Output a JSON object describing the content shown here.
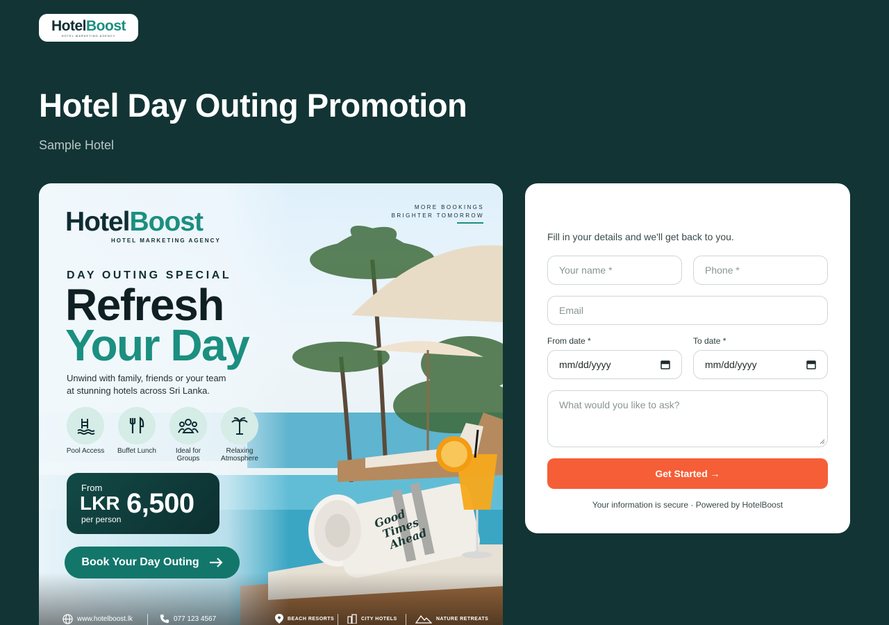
{
  "header": {
    "logo_text_h": "Hotel",
    "logo_text_b": "Boost",
    "logo_subtext": "HOTEL MARKETING AGENCY",
    "title": "Hotel Day Outing Promotion",
    "subtitle": "Sample Hotel"
  },
  "poster": {
    "logo_text_h": "Hotel",
    "logo_text_b": "Boost",
    "logo_subtext": "HOTEL MARKETING AGENCY",
    "tagline_line1": "MORE BOOKINGS",
    "tagline_line2": "BRIGHTER TOMORROW",
    "kicker": "DAY OUTING SPECIAL",
    "headline_line1": "Refresh",
    "headline_line2": "Your Day",
    "blurb_line1": "Unwind with family, friends or your team",
    "blurb_line2": "at stunning hotels across Sri Lanka.",
    "amenities": [
      {
        "icon": "pool-icon",
        "line1": "Pool Access",
        "line2": ""
      },
      {
        "icon": "fork-knife-icon",
        "line1": "Buffet Lunch",
        "line2": ""
      },
      {
        "icon": "group-icon",
        "line1": "Ideal for",
        "line2": "Groups"
      },
      {
        "icon": "palm-tree-icon",
        "line1": "Relaxing",
        "line2": "Atmosphere"
      }
    ],
    "price_from": "From",
    "price_currency": "LKR",
    "price_value": "6,500",
    "price_per": "per person",
    "book_button": "Book Your Day Outing",
    "towel_text_line1": "Good",
    "towel_text_line2": "Times",
    "towel_text_line3": "Ahead",
    "footer": {
      "website": "www.hotelboost.lk",
      "phone": "077 123 4567",
      "beach": "BEACH RESORTS",
      "city": "CITY HOTELS",
      "nature": "NATURE RETREATS"
    }
  },
  "form": {
    "intro": "Fill in your details and we'll get back to you.",
    "name_placeholder": "Your name *",
    "phone_placeholder": "Phone *",
    "email_placeholder": "Email",
    "from_label": "From date *",
    "to_label": "To date *",
    "from_value": "mm/dd/yyyy",
    "to_value": "mm/dd/yyyy",
    "message_placeholder": "What would you like to ask?",
    "submit_label": "Get Started →",
    "secure_note": "Your information is secure · Powered by HotelBoost"
  },
  "colors": {
    "background": "#123434",
    "accent_teal": "#1b8f80",
    "submit_orange": "#f55e36"
  }
}
